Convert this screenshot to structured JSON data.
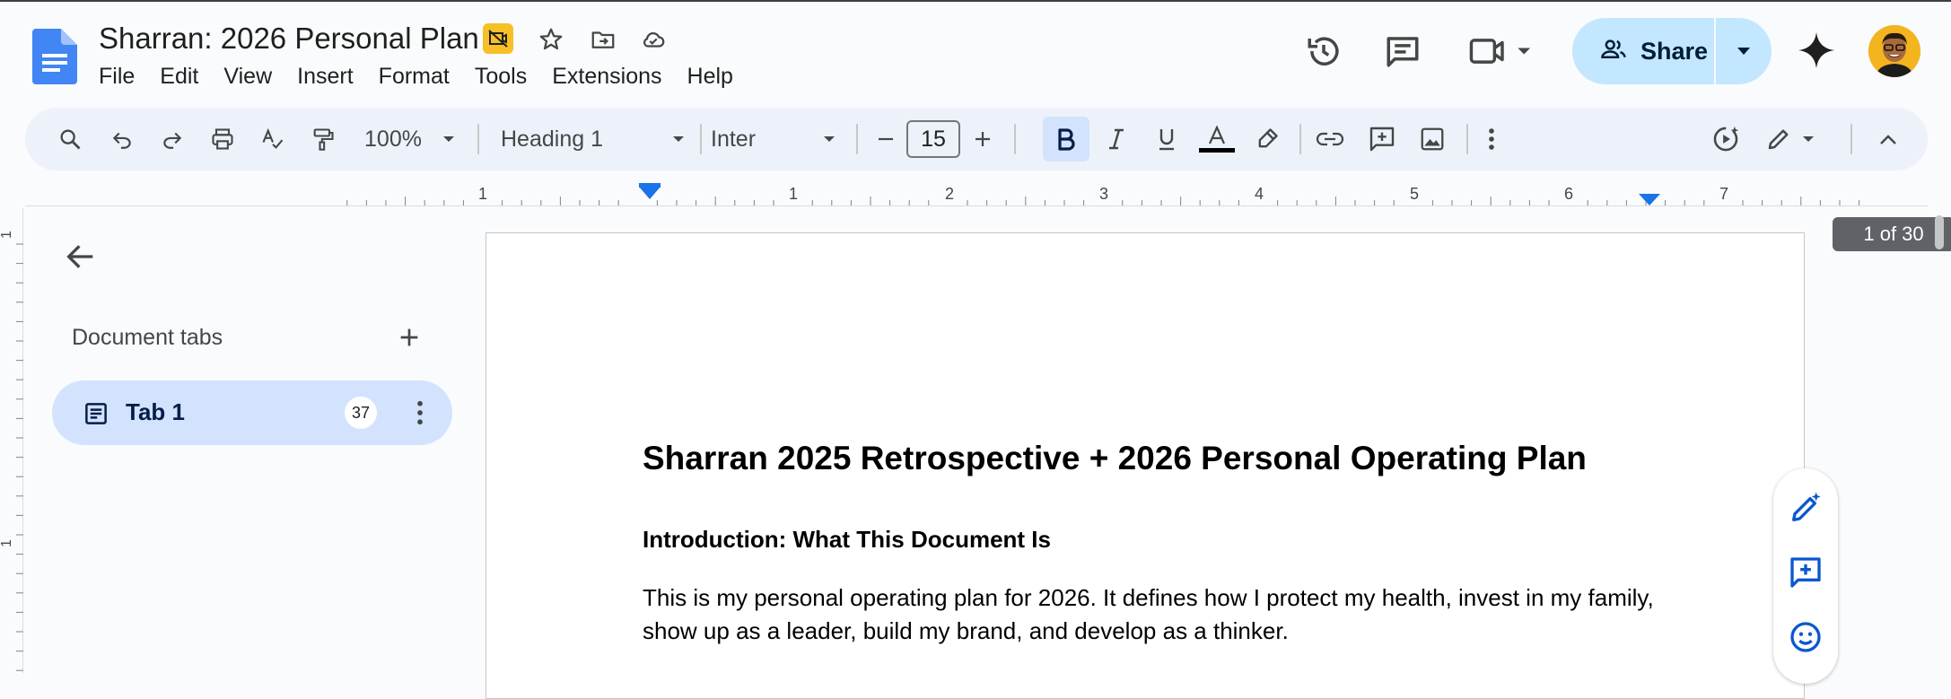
{
  "document": {
    "title": "Sharran: 2026 Personal Plan"
  },
  "menu": [
    "File",
    "Edit",
    "View",
    "Insert",
    "Format",
    "Tools",
    "Extensions",
    "Help"
  ],
  "share": {
    "label": "Share"
  },
  "toolbar": {
    "zoom": "100%",
    "style": "Heading 1",
    "font": "Inter",
    "font_size": "15"
  },
  "ruler": {
    "labels": [
      "1",
      "1",
      "2",
      "3",
      "4",
      "5",
      "6",
      "7"
    ]
  },
  "sidebar": {
    "header": "Document tabs",
    "tabs": [
      {
        "label": "Tab 1",
        "count": "37"
      }
    ]
  },
  "page_counter": "1 of 30",
  "content": {
    "heading1": "Sharran 2025 Retrospective + 2026 Personal Operating Plan",
    "heading2": "Introduction: What This Document Is",
    "paragraph": "This is my personal operating plan for 2026. It defines how I protect my health, invest in my family, show up as a leader, build my brand, and develop as a thinker."
  },
  "colors": {
    "accent": "#0b57d0",
    "share_bg": "#c2e7ff",
    "toolbar_bg": "#edf2fa",
    "tab_active_bg": "#d3e3fd"
  },
  "icons": {
    "logo": "docs-logo-icon",
    "history": "history-icon",
    "comments": "comments-icon",
    "meet": "video-camera-icon",
    "gemini": "gemini-sparkle-icon"
  }
}
